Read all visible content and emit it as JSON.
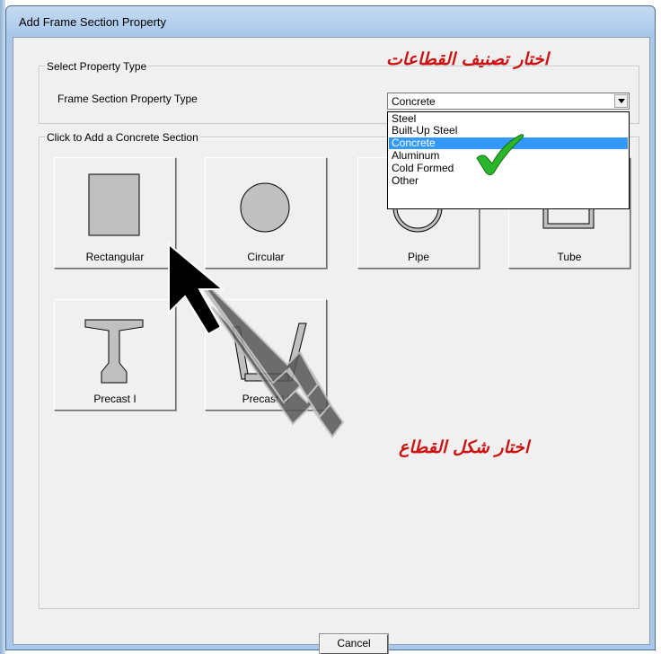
{
  "window": {
    "title": "Add Frame Section Property"
  },
  "property_type_group": {
    "legend": "Select Property Type",
    "field_label": "Frame Section Property Type",
    "selected": "Concrete",
    "options": [
      "Steel",
      "Built-Up Steel",
      "Concrete",
      "Aluminum",
      "Cold Formed",
      "Other"
    ]
  },
  "section_group": {
    "legend": "Click to Add a Concrete Section",
    "tiles": [
      "Rectangular",
      "Circular",
      "Pipe",
      "Tube",
      "Precast I",
      "Precast U"
    ]
  },
  "buttons": {
    "cancel": "Cancel"
  },
  "annotations": {
    "choose_type": "اختار تصنيف القطاعات",
    "choose_shape": "اختار شكل القطاع"
  },
  "colors": {
    "selection": "#3399ff",
    "annotation": "#cc1111",
    "check": "#22aa22"
  }
}
